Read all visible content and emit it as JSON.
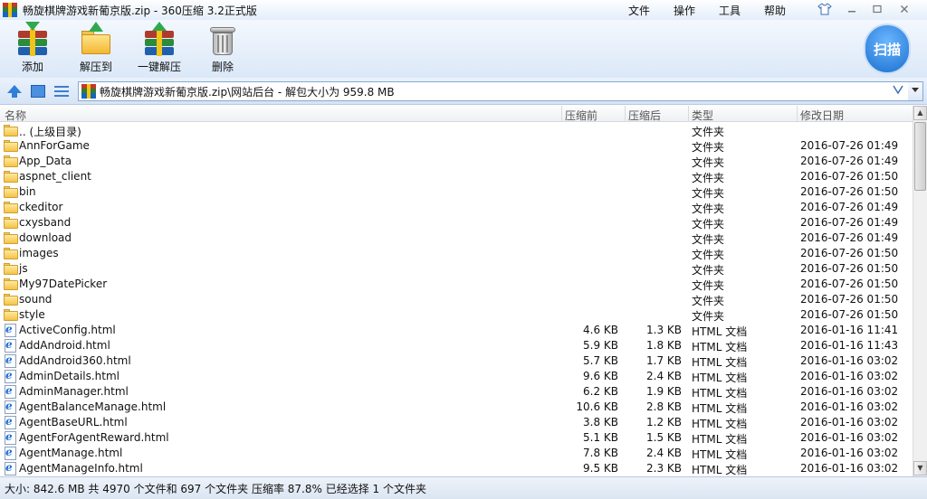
{
  "window": {
    "title": "畅旋棋牌游戏新葡京版.zip - 360压缩 3.2正式版",
    "menu": [
      "文件",
      "操作",
      "工具",
      "帮助"
    ]
  },
  "toolbar": {
    "add_label": "添加",
    "extract_to_label": "解压到",
    "one_click_extract_label": "一键解压",
    "delete_label": "删除",
    "scan_label": "扫描"
  },
  "address": {
    "path": "畅旋棋牌游戏新葡京版.zip\\网站后台 - 解包大小为 959.8 MB"
  },
  "columns": {
    "name": "名称",
    "size": "压缩前",
    "compressed": "压缩后",
    "type": "类型",
    "modified": "修改日期"
  },
  "files": [
    {
      "name": ".. (上级目录)",
      "size": "",
      "compressed": "",
      "type": "文件夹",
      "date": "",
      "kind": "folder"
    },
    {
      "name": "AnnForGame",
      "size": "",
      "compressed": "",
      "type": "文件夹",
      "date": "2016-07-26 01:49",
      "kind": "folder"
    },
    {
      "name": "App_Data",
      "size": "",
      "compressed": "",
      "type": "文件夹",
      "date": "2016-07-26 01:49",
      "kind": "folder"
    },
    {
      "name": "aspnet_client",
      "size": "",
      "compressed": "",
      "type": "文件夹",
      "date": "2016-07-26 01:50",
      "kind": "folder"
    },
    {
      "name": "bin",
      "size": "",
      "compressed": "",
      "type": "文件夹",
      "date": "2016-07-26 01:50",
      "kind": "folder"
    },
    {
      "name": "ckeditor",
      "size": "",
      "compressed": "",
      "type": "文件夹",
      "date": "2016-07-26 01:49",
      "kind": "folder"
    },
    {
      "name": "cxysband",
      "size": "",
      "compressed": "",
      "type": "文件夹",
      "date": "2016-07-26 01:49",
      "kind": "folder"
    },
    {
      "name": "download",
      "size": "",
      "compressed": "",
      "type": "文件夹",
      "date": "2016-07-26 01:49",
      "kind": "folder"
    },
    {
      "name": "images",
      "size": "",
      "compressed": "",
      "type": "文件夹",
      "date": "2016-07-26 01:50",
      "kind": "folder"
    },
    {
      "name": "js",
      "size": "",
      "compressed": "",
      "type": "文件夹",
      "date": "2016-07-26 01:50",
      "kind": "folder"
    },
    {
      "name": "My97DatePicker",
      "size": "",
      "compressed": "",
      "type": "文件夹",
      "date": "2016-07-26 01:50",
      "kind": "folder"
    },
    {
      "name": "sound",
      "size": "",
      "compressed": "",
      "type": "文件夹",
      "date": "2016-07-26 01:50",
      "kind": "folder"
    },
    {
      "name": "style",
      "size": "",
      "compressed": "",
      "type": "文件夹",
      "date": "2016-07-26 01:50",
      "kind": "folder"
    },
    {
      "name": "ActiveConfig.html",
      "size": "4.6 KB",
      "compressed": "1.3 KB",
      "type": "HTML 文档",
      "date": "2016-01-16 11:41",
      "kind": "html"
    },
    {
      "name": "AddAndroid.html",
      "size": "5.9 KB",
      "compressed": "1.8 KB",
      "type": "HTML 文档",
      "date": "2016-01-16 11:43",
      "kind": "html"
    },
    {
      "name": "AddAndroid360.html",
      "size": "5.7 KB",
      "compressed": "1.7 KB",
      "type": "HTML 文档",
      "date": "2016-01-16 03:02",
      "kind": "html"
    },
    {
      "name": "AdminDetails.html",
      "size": "9.6 KB",
      "compressed": "2.4 KB",
      "type": "HTML 文档",
      "date": "2016-01-16 03:02",
      "kind": "html"
    },
    {
      "name": "AdminManager.html",
      "size": "6.2 KB",
      "compressed": "1.9 KB",
      "type": "HTML 文档",
      "date": "2016-01-16 03:02",
      "kind": "html"
    },
    {
      "name": "AgentBalanceManage.html",
      "size": "10.6 KB",
      "compressed": "2.8 KB",
      "type": "HTML 文档",
      "date": "2016-01-16 03:02",
      "kind": "html"
    },
    {
      "name": "AgentBaseURL.html",
      "size": "3.8 KB",
      "compressed": "1.2 KB",
      "type": "HTML 文档",
      "date": "2016-01-16 03:02",
      "kind": "html"
    },
    {
      "name": "AgentForAgentReward.html",
      "size": "5.1 KB",
      "compressed": "1.5 KB",
      "type": "HTML 文档",
      "date": "2016-01-16 03:02",
      "kind": "html"
    },
    {
      "name": "AgentManage.html",
      "size": "7.8 KB",
      "compressed": "2.4 KB",
      "type": "HTML 文档",
      "date": "2016-01-16 03:02",
      "kind": "html"
    },
    {
      "name": "AgentManageInfo.html",
      "size": "9.5 KB",
      "compressed": "2.3 KB",
      "type": "HTML 文档",
      "date": "2016-01-16 03:02",
      "kind": "html"
    }
  ],
  "status": {
    "text": "大小: 842.6 MB 共 4970 个文件和 697 个文件夹 压缩率 87.8% 已经选择 1 个文件夹"
  }
}
